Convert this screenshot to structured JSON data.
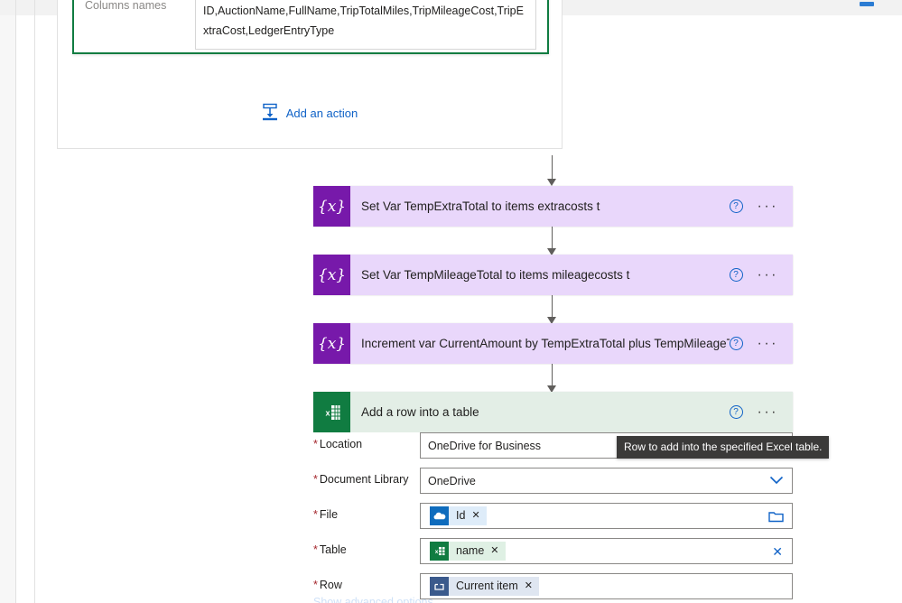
{
  "scope_card": {
    "fields": [
      {
        "label": "Columns names",
        "value": "ID,AuctionName,FullName,TripTotalMiles,TripMileageCost,TripExtraCost,LedgerEntryType"
      }
    ],
    "add_action_label": "Add an action",
    "add_action_icon": "add-action-icon"
  },
  "actions": [
    {
      "title": "Set Var TempExtraTotal to items extracosts t",
      "icon": "variable-icon",
      "icon_glyph": "{x}",
      "kind": "variable",
      "help_icon": "help-icon",
      "help_glyph": "?",
      "more_icon": "more-options-icon",
      "more_glyph": "···"
    },
    {
      "title": "Set Var TempMileageTotal to items mileagecosts t",
      "icon": "variable-icon",
      "icon_glyph": "{x}",
      "kind": "variable",
      "help_icon": "help-icon",
      "help_glyph": "?",
      "more_icon": "more-options-icon",
      "more_glyph": "···"
    },
    {
      "title": "Increment var CurrentAmount by TempExtraTotal plus TempMileageTotal t",
      "icon": "variable-icon",
      "icon_glyph": "{x}",
      "kind": "variable",
      "help_icon": "help-icon",
      "help_glyph": "?",
      "more_icon": "more-options-icon",
      "more_glyph": "···"
    },
    {
      "title": "Add a row into a table",
      "icon": "excel-icon",
      "icon_glyph": "",
      "kind": "excel",
      "help_icon": "help-icon",
      "help_glyph": "?",
      "more_icon": "more-options-icon",
      "more_glyph": "···"
    }
  ],
  "excel_form": {
    "fields": [
      {
        "name": "location",
        "label": "Location",
        "required_mark": "*",
        "type": "text",
        "value": "OneDrive for Business"
      },
      {
        "name": "document-library",
        "label": "Document Library",
        "required_mark": "*",
        "type": "dropdown",
        "value": "OneDrive",
        "chevron_icon": "chevron-down-icon"
      },
      {
        "name": "file",
        "label": "File",
        "required_mark": "*",
        "type": "token",
        "token_text": "Id",
        "token_icon": "onedrive-icon",
        "token_remove_glyph": "✕",
        "trailing_icon": "folder-picker-icon"
      },
      {
        "name": "table",
        "label": "Table",
        "required_mark": "*",
        "type": "token",
        "token_text": "name",
        "token_icon": "excel-table-icon",
        "token_remove_glyph": "✕",
        "trailing_icon": "clear-icon",
        "trailing_glyph": "✕"
      },
      {
        "name": "row",
        "label": "Row",
        "required_mark": "*",
        "type": "token",
        "token_text": "Current item",
        "token_icon": "apply-to-each-icon",
        "token_remove_glyph": "✕"
      }
    ],
    "advanced_options_label": "Show advanced options"
  },
  "tooltip": {
    "text": "Row to add into the specified Excel table."
  },
  "colors": {
    "variable_accent": "#7719aa",
    "variable_card_bg": "#e9d7fb",
    "excel_accent": "#107c41",
    "excel_card_bg": "#e3eee6",
    "link": "#0f62c7",
    "required": "#a4262c",
    "tooltip_bg": "#3b3a39"
  }
}
